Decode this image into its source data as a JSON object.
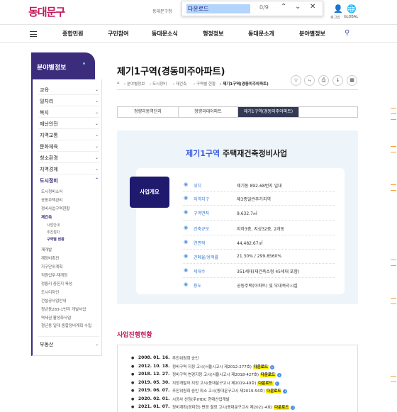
{
  "header": {
    "logo": "동대문구",
    "site_label": "동대문구청",
    "login_label": "로그인",
    "global_label": "GLOBAL"
  },
  "find": {
    "query": "다운로드",
    "count": "0/9"
  },
  "nav": {
    "items": [
      "종합민원",
      "구민참여",
      "동대문소식",
      "행정정보",
      "동대문소개",
      "분야별정보"
    ]
  },
  "sidebar": {
    "title": "분야별정보",
    "items": [
      {
        "label": "교육"
      },
      {
        "label": "일자리"
      },
      {
        "label": "복지"
      },
      {
        "label": "재난안전"
      },
      {
        "label": "지역교통"
      },
      {
        "label": "문화체육"
      },
      {
        "label": "청소환경"
      },
      {
        "label": "지역경제"
      },
      {
        "label": "도시정비"
      }
    ],
    "subitems": [
      "도시정비소식",
      "공동주택관리",
      "정비사업구역현황",
      "재건축",
      "사업안내",
      "추진절차",
      "구역별 현황",
      "재개발",
      "재정비촉진",
      "지구단위계획",
      "직원업무·재개정",
      "정릉리 증진지 육성",
      "도시디자인",
      "건설공사업안내",
      "청년동283-1번지 개발사업",
      "역세권 활성화사업",
      "청년동 일대 종합정비계획 수립"
    ],
    "last_item": "부동산"
  },
  "page": {
    "title": "제기1구역(경동미주아파트)",
    "breadcrumb": [
      "분야별정보",
      "도시정비",
      "재건축",
      "구역별 현황",
      "제기1구역(경동미주아파트)"
    ]
  },
  "tabs": [
    "청량리동역단지",
    "청량리대아파트",
    "제기1구역(경동미주아파트)"
  ],
  "panel": {
    "title_highlight": "제기1구역",
    "title_rest": "주택재건축정비사업",
    "badge": "사업개요",
    "rows": [
      {
        "label": "위치",
        "value": "제기동 892-68번지 일대"
      },
      {
        "label": "지역지구",
        "value": "제3종일반주거지역"
      },
      {
        "label": "구역면적",
        "value": "9,632.7㎡"
      },
      {
        "label": "건축규모",
        "value": "지하3층, 지상32층, 2개동"
      },
      {
        "label": "연면적",
        "value": "44,482.67㎡"
      },
      {
        "label": "건폐율/용적률",
        "value": "21.30% / 299.8560%"
      },
      {
        "label": "세대수",
        "value": "351세대(재건축소형 45세대 포함)"
      },
      {
        "label": "용도",
        "value": "공동주택(아파트) 및 부대복리시설"
      }
    ]
  },
  "history": {
    "title": "사업진행현황",
    "download_label": "다운로드",
    "rows": [
      {
        "date": "2008. 01. 16.",
        "text": "추진위원회 승인",
        "dl": false
      },
      {
        "date": "2012. 10. 18.",
        "text": "정비구역 지정 고시(서울시고시 제2012-277호)",
        "dl": true
      },
      {
        "date": "2018. 12. 27.",
        "text": "정비구역 변경지정 고시(서울시고시 제2018-427호)",
        "dl": true
      },
      {
        "date": "2019. 05. 30.",
        "text": "지정개발자 지정 고시(동대문구고시 제2019-49호)",
        "dl": true
      },
      {
        "date": "2019. 06. 07.",
        "text": "추진위원회 승인 취소 고시(동대문구고시 제2019-54호)",
        "dl": true
      },
      {
        "date": "2020. 02. 01.",
        "text": "시공사 선정(주)HDC 현대산업개발",
        "dl": false
      },
      {
        "date": "2021. 01. 07.",
        "text": "정비계획(경미한) 변경 결정 고시(동대문구고시 제2021-4호)",
        "dl": true
      },
      {
        "date": "2021. 01. 21.",
        "text": "사업시행계획인가 고시(동대문구고시 제2021-10호)",
        "dl": true
      }
    ]
  }
}
